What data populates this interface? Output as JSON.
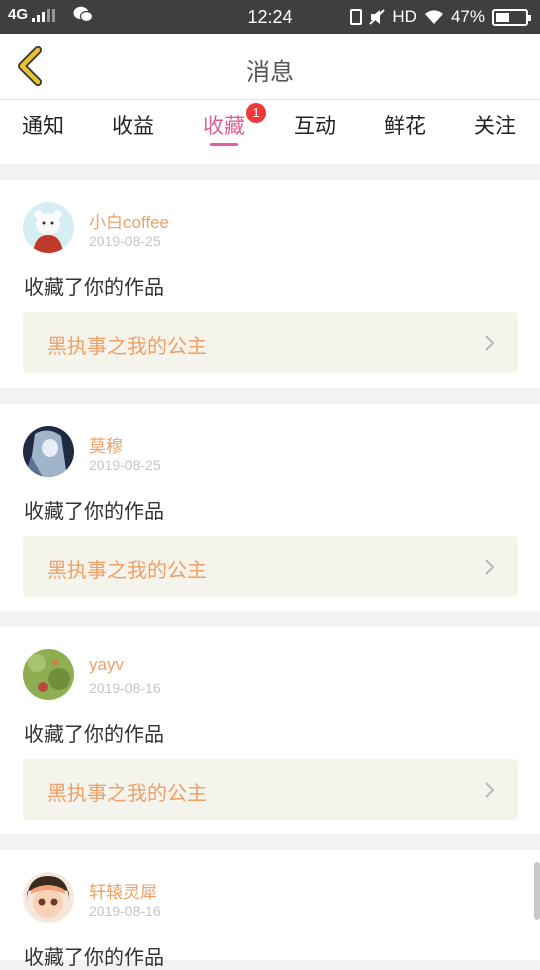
{
  "status_bar": {
    "network": "4G",
    "time": "12:24",
    "hd": "HD",
    "battery_percent": "47%",
    "battery_level": 0.47
  },
  "header": {
    "title": "消息",
    "back_icon": "chevron-left-icon"
  },
  "tabs": [
    {
      "label": "通知",
      "active": false
    },
    {
      "label": "收益",
      "active": false
    },
    {
      "label": "收藏",
      "active": true,
      "badge": "1"
    },
    {
      "label": "互动",
      "active": false
    },
    {
      "label": "鲜花",
      "active": false
    },
    {
      "label": "关注",
      "active": false
    }
  ],
  "messages": [
    {
      "username": "小白coffee",
      "date": "2019-08-25",
      "action": "收藏了你的作品",
      "work_title": "黑执事之我的公主",
      "avatar_colors": [
        "#d6eef2",
        "#c0392b"
      ]
    },
    {
      "username": "莫穆",
      "date": "2019-08-25",
      "action": "收藏了你的作品",
      "work_title": "黑执事之我的公主",
      "avatar_colors": [
        "#1f2b45",
        "#9fb3c9"
      ]
    },
    {
      "username": "yayv",
      "date": "2019-08-16",
      "action": "收藏了你的作品",
      "work_title": "黑执事之我的公主",
      "avatar_colors": [
        "#8fae52",
        "#b64a3c"
      ]
    },
    {
      "username": "轩辕灵犀",
      "date": "2019-08-16",
      "action": "收藏了你的作品",
      "work_title": "",
      "avatar_colors": [
        "#3a2a1f",
        "#f2a37a"
      ]
    }
  ],
  "colors": {
    "accent": "#e2609a",
    "username": "#eea066",
    "badge": "#f03a3a",
    "back_arrow": "#e9c32e"
  }
}
